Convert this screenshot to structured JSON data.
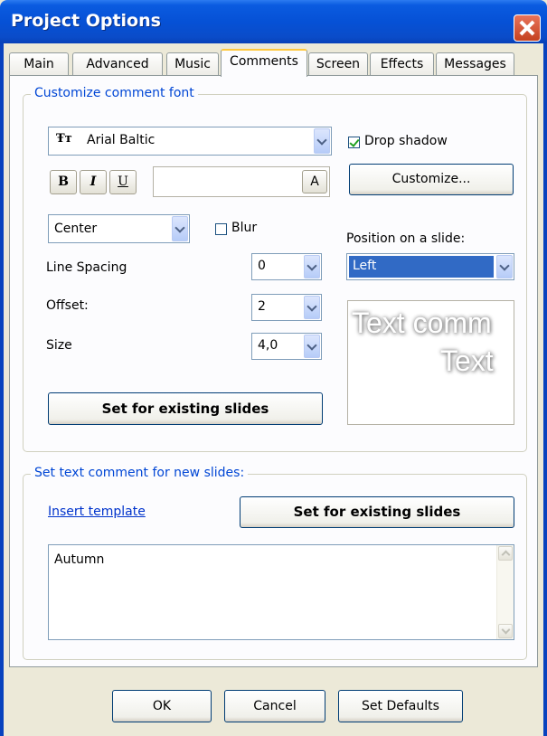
{
  "window": {
    "title": "Project Options"
  },
  "tabs": [
    "Main",
    "Advanced",
    "Music",
    "Comments",
    "Screen",
    "Effects",
    "Messages"
  ],
  "active_tab": "Comments",
  "font_group": {
    "legend": "Customize comment font",
    "font_name": "Arial Baltic",
    "font_icon_glyph": "Ŧт",
    "bold_label": "B",
    "italic_label": "I",
    "underline_label": "U",
    "color_button_label": "A",
    "drop_shadow_label": "Drop shadow",
    "drop_shadow_checked": true,
    "customize_button": "Customize...",
    "alignment_value": "Center",
    "blur_label": "Blur",
    "blur_checked": false,
    "position_label": "Position on a slide:",
    "position_value": "Left",
    "line_spacing_label": "Line Spacing",
    "line_spacing_value": "0",
    "offset_label": "Offset:",
    "offset_value": "2",
    "size_label": "Size",
    "size_value": "4,0",
    "set_existing_button": "Set for existing slides",
    "preview_line1": "Text comm",
    "preview_line2": "Text"
  },
  "comment_group": {
    "legend": "Set text comment for new slides:",
    "insert_template_link": "Insert template",
    "set_existing_button": "Set for existing slides",
    "comment_text": "Autumn"
  },
  "footer": {
    "ok": "OK",
    "cancel": "Cancel",
    "set_defaults": "Set Defaults"
  },
  "colors": {
    "accent": "#0046D5",
    "titlebar": "#0A5BE0",
    "close": "#C4411F",
    "selection": "#316AC5"
  }
}
